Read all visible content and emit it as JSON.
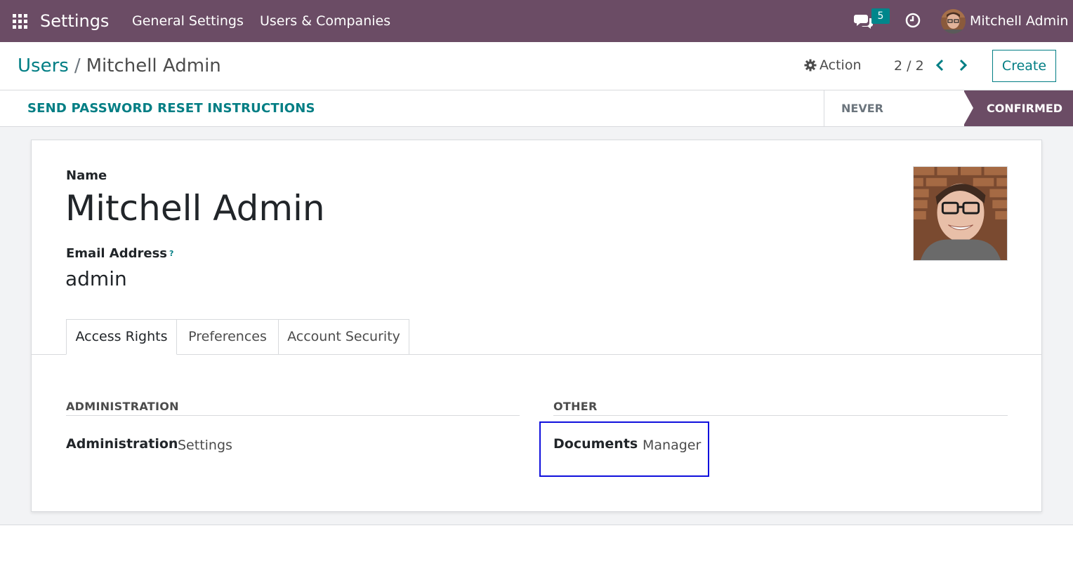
{
  "navbar": {
    "app_title": "Settings",
    "menu": [
      "General Settings",
      "Users & Companies"
    ],
    "chat_count": "5",
    "user_name": "Mitchell Admin"
  },
  "control_panel": {
    "breadcrumb_parent": "Users",
    "breadcrumb_separator": "/",
    "breadcrumb_current": "Mitchell Admin",
    "action_label": "Action",
    "pager": "2 / 2",
    "create_label": "Create"
  },
  "statusbar": {
    "reset_button": "SEND PASSWORD RESET INSTRUCTIONS",
    "stages": [
      "NEVER CONNECTED",
      "CONFIRMED"
    ],
    "active_stage": "CONFIRMED"
  },
  "form": {
    "name_label": "Name",
    "name_value": "Mitchell Admin",
    "email_label": "Email Address",
    "email_help": "?",
    "email_value": "admin",
    "tabs": [
      "Access Rights",
      "Preferences",
      "Account Security"
    ],
    "active_tab": "Access Rights",
    "groups": [
      {
        "title": "ADMINISTRATION",
        "field_label": "Administration",
        "field_value": "Settings"
      },
      {
        "title": "OTHER",
        "field_label": "Documents",
        "field_value": "Manager"
      }
    ]
  },
  "colors": {
    "navbar": "#6b4c65",
    "accent": "#017e84",
    "highlight": "#1010dd"
  }
}
